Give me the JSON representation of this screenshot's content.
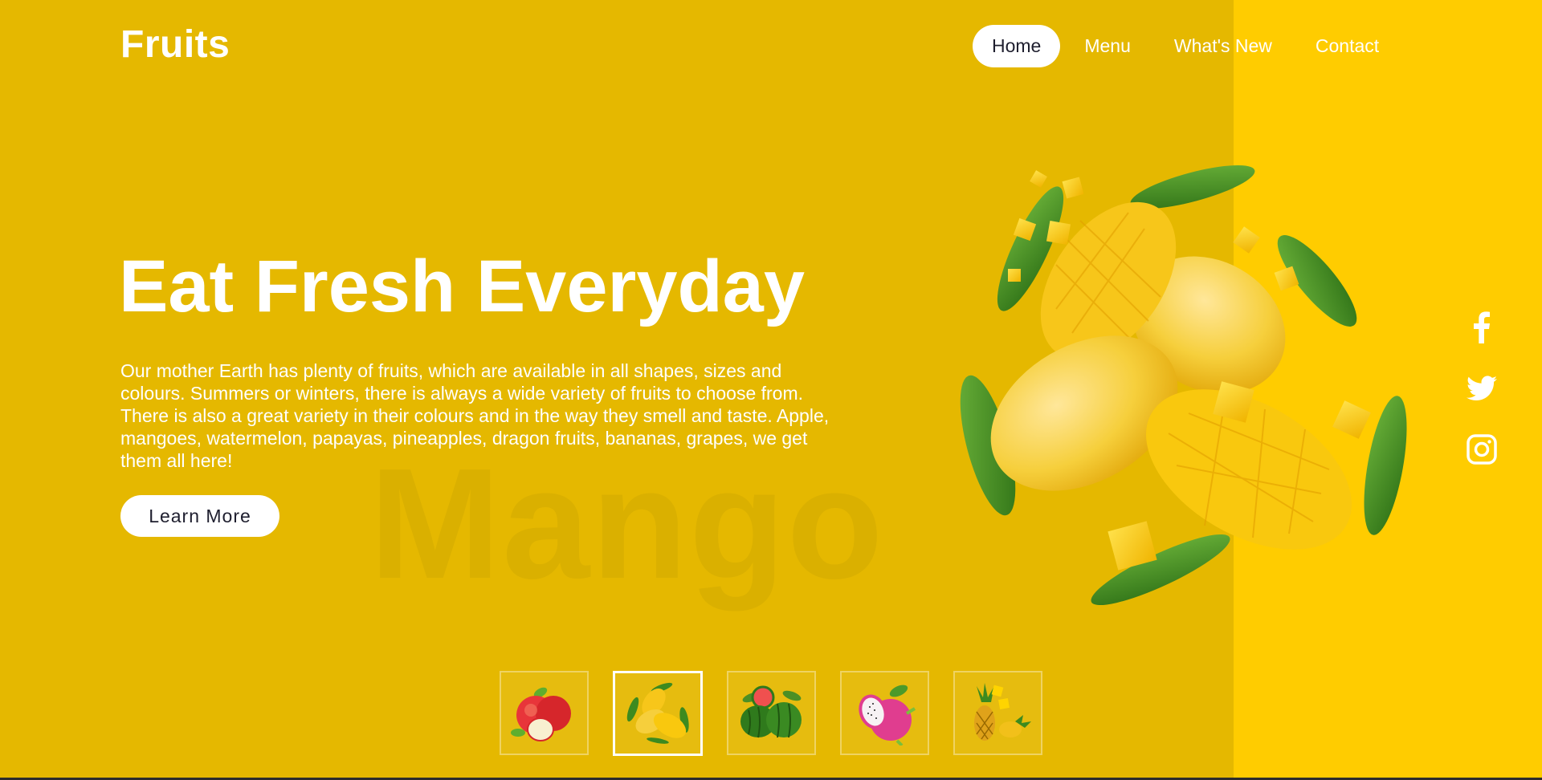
{
  "brand": {
    "logo": "Fruits"
  },
  "nav": {
    "items": [
      {
        "label": "Home",
        "active": true
      },
      {
        "label": "Menu",
        "active": false
      },
      {
        "label": "What's New",
        "active": false
      },
      {
        "label": "Contact",
        "active": false
      }
    ]
  },
  "hero": {
    "title": "Eat Fresh Everyday",
    "description": "Our mother Earth has plenty of fruits, which are available in all shapes, sizes and colours. Summers or winters, there is always a wide variety of fruits to choose from. There is also a great variety in their colours and in the way they smell and taste. Apple, mangoes, watermelon, papayas, pineapples, dragon fruits, bananas, grapes, we get them all here!",
    "button_label": "Learn More",
    "watermark": "Mango",
    "image": "mango-fruit-image"
  },
  "social": {
    "icons": [
      "facebook-icon",
      "twitter-icon",
      "instagram-icon"
    ]
  },
  "thumbnails": [
    {
      "fruit": "apple",
      "active": false
    },
    {
      "fruit": "mango",
      "active": true
    },
    {
      "fruit": "watermelon",
      "active": false
    },
    {
      "fruit": "dragon-fruit",
      "active": false
    },
    {
      "fruit": "pineapple",
      "active": false
    }
  ],
  "colors": {
    "background": "#e5b800",
    "right_panel": "#ffcc00",
    "text": "#ffffff",
    "button_text": "#1e1e2e",
    "leaf": "#3d8a1f",
    "mango": "#f6c21c"
  }
}
